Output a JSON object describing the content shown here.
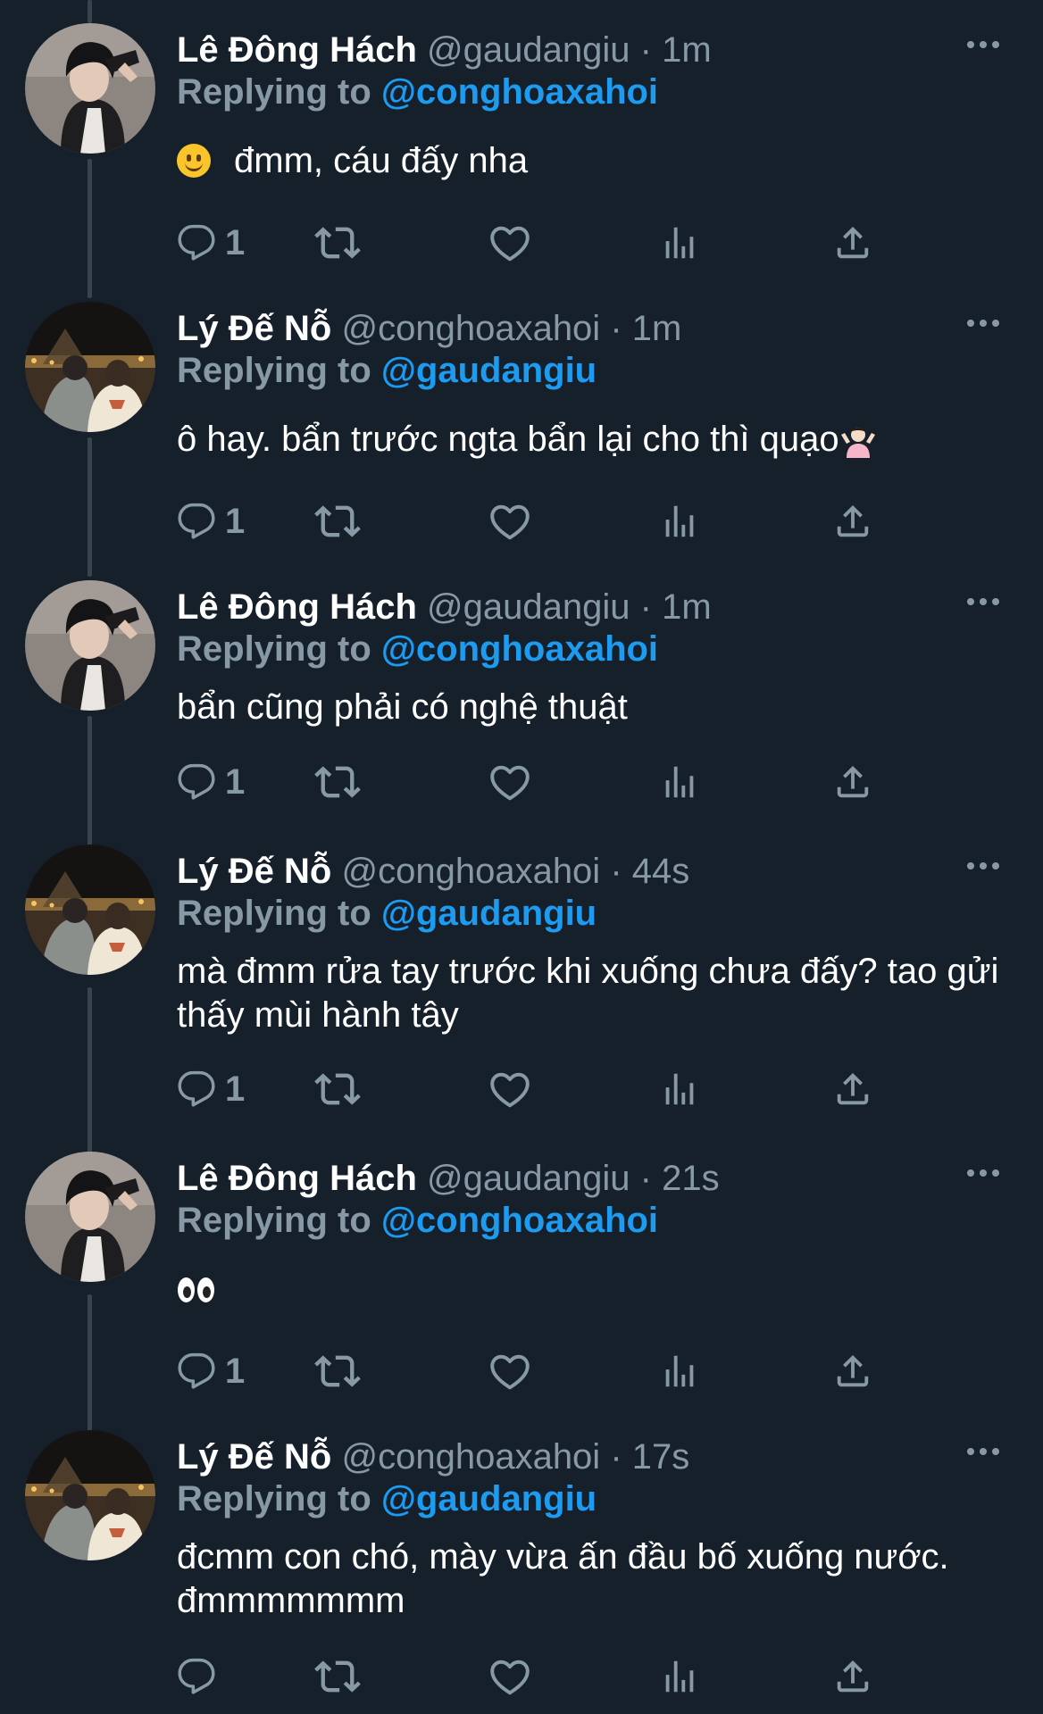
{
  "tweets": [
    {
      "author": "Lê Đông Hách",
      "handle": "@gaudangiu",
      "dot": "·",
      "time": "1m",
      "replying_label": "Replying to",
      "replying_to": "@conghoaxahoi",
      "text": "đmm, cáu đấy nha",
      "emoji": "slightly-smiling-face",
      "reply_count": "1"
    },
    {
      "author": "Lý Đế Nỗ",
      "handle": "@conghoaxahoi",
      "dot": "·",
      "time": "1m",
      "replying_label": "Replying to",
      "replying_to": "@gaudangiu",
      "text": "ô hay. bẩn trước ngta bẩn lại cho thì quạo",
      "emoji": "person-shrugging",
      "reply_count": "1"
    },
    {
      "author": "Lê Đông Hách",
      "handle": "@gaudangiu",
      "dot": "·",
      "time": "1m",
      "replying_label": "Replying to",
      "replying_to": "@conghoaxahoi",
      "text": "bẩn cũng phải có nghệ thuật",
      "reply_count": "1"
    },
    {
      "author": "Lý Đế Nỗ",
      "handle": "@conghoaxahoi",
      "dot": "·",
      "time": "44s",
      "replying_label": "Replying to",
      "replying_to": "@gaudangiu",
      "text": "mà đmm rửa tay trước khi xuống chưa đấy? tao gửi thấy mùi hành tây",
      "reply_count": "1"
    },
    {
      "author": "Lê Đông Hách",
      "handle": "@gaudangiu",
      "dot": "·",
      "time": "21s",
      "replying_label": "Replying to",
      "replying_to": "@conghoaxahoi",
      "text": "",
      "emoji": "eyes",
      "reply_count": "1"
    },
    {
      "author": "Lý Đế Nỗ",
      "handle": "@conghoaxahoi",
      "dot": "·",
      "time": "17s",
      "replying_label": "Replying to",
      "replying_to": "@gaudangiu",
      "text": "đcmm con chó, mày vừa ấn đầu bố xuống nước. đmmmmmmm",
      "reply_count": ""
    }
  ],
  "icons": {
    "reply": "reply-icon",
    "retweet": "retweet-icon",
    "like": "like-icon",
    "analytics": "analytics-icon",
    "share": "share-icon",
    "more": "more-options-icon"
  },
  "colors": {
    "background": "#15202b",
    "secondary_text": "#8899a6",
    "link": "#1d9bf0",
    "thread_line": "#38444d"
  }
}
